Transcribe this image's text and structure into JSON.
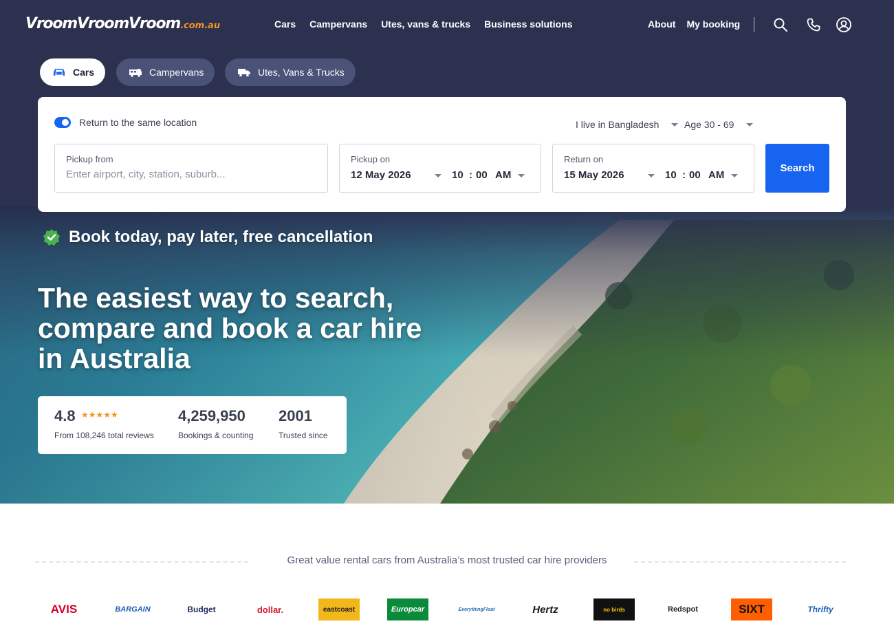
{
  "brand": {
    "name": "VroomVroomVroom",
    "tld": ".com.au"
  },
  "nav": {
    "links": [
      "Cars",
      "Campervans",
      "Utes, vans & trucks",
      "Business solutions"
    ],
    "right_links": [
      "About",
      "My booking"
    ],
    "icons": [
      "search-icon",
      "phone-icon",
      "account-icon"
    ]
  },
  "vehicle_tabs": [
    {
      "label": "Cars",
      "icon": "car-icon",
      "active": true
    },
    {
      "label": "Campervans",
      "icon": "campervan-icon",
      "active": false
    },
    {
      "label": "Utes, Vans & Trucks",
      "icon": "truck-icon",
      "active": false
    }
  ],
  "search": {
    "same_location_label": "Return to the same location",
    "same_location_on": true,
    "residence": "I live in Bangladesh",
    "age": "Age 30 - 69",
    "pickup_from": {
      "label": "Pickup from",
      "placeholder": "Enter airport, city, station, suburb..."
    },
    "pickup_on": {
      "label": "Pickup on",
      "date": "12 May 2026",
      "hour": "10",
      "sep": ":",
      "minute": "00",
      "ampm": "AM"
    },
    "return_on": {
      "label": "Return on",
      "date": "15 May 2026",
      "hour": "10",
      "sep": ":",
      "minute": "00",
      "ampm": "AM"
    },
    "button_label": "Search"
  },
  "hero": {
    "promise": "Book today, pay later, free cancellation",
    "headline": "The easiest way to search, compare and book a car hire in Australia"
  },
  "stats": {
    "rating": "4.8",
    "stars": "★★★★★",
    "rating_caption": "From 108,246 total reviews",
    "bookings": "4,259,950",
    "bookings_caption": "Bookings & counting",
    "since": "2001",
    "since_caption": "Trusted since"
  },
  "providers": {
    "title": "Great value rental cars from Australia’s most trusted car hire providers",
    "logos": [
      {
        "name": "AVIS",
        "color": "#d4002a",
        "bg": "#ffffff"
      },
      {
        "name": "BARGAIN",
        "color": "#1f5fb4",
        "bg": "#ffffff"
      },
      {
        "name": "Budget",
        "color": "#1a2a5a",
        "bg": "#ffffff"
      },
      {
        "name": "dollar.",
        "color": "#d11a2a",
        "bg": "#ffffff"
      },
      {
        "name": "eastcoast",
        "color": "#1a1a1a",
        "bg": "#f2b71b"
      },
      {
        "name": "Europcar",
        "color": "#ffffff",
        "bg": "#0b8a3b"
      },
      {
        "name": "EverythingFloat",
        "color": "#2a6fb8",
        "bg": "#ffffff"
      },
      {
        "name": "Hertz",
        "color": "#1a1a1a",
        "bg": "#ffffff"
      },
      {
        "name": "no birds",
        "color": "#f7c600",
        "bg": "#111111"
      },
      {
        "name": "Redspot",
        "color": "#222222",
        "bg": "#ffffff"
      },
      {
        "name": "SIXT",
        "color": "#111111",
        "bg": "#ff5f00"
      },
      {
        "name": "Thrifty",
        "color": "#1f5fb4",
        "bg": "#ffffff"
      }
    ]
  }
}
